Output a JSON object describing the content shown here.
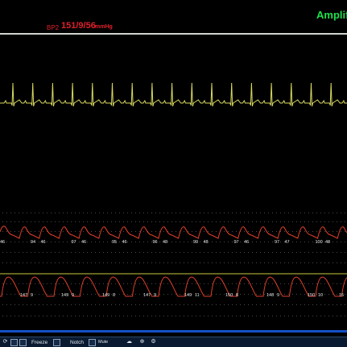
{
  "header": {
    "amplifier_label": "Amplifi",
    "bp_label": "BP2",
    "bp_value": "151/9/56",
    "bp_unit": "mmHg"
  },
  "channel_upper": {
    "values": [
      "46",
      "94",
      "46",
      "97",
      "46",
      "95",
      "46",
      "96",
      "48",
      "99",
      "48",
      "97",
      "46",
      "97",
      "47",
      "100",
      "48"
    ]
  },
  "channel_lower": {
    "values": [
      "147",
      "9",
      "149",
      "9",
      "149",
      "8",
      "147",
      "9",
      "149",
      "11",
      "150",
      "8",
      "148",
      "9",
      "150",
      "10",
      "15"
    ]
  },
  "toolbar": {
    "freeze_label": "Freeze",
    "notch_label": "Notch",
    "mute_label": "Mute"
  },
  "colors": {
    "ecg_trace": "#d8d860",
    "pressure_trace": "#e0402a",
    "accent_green": "#1ee04a",
    "bp_red": "#e0202a"
  }
}
